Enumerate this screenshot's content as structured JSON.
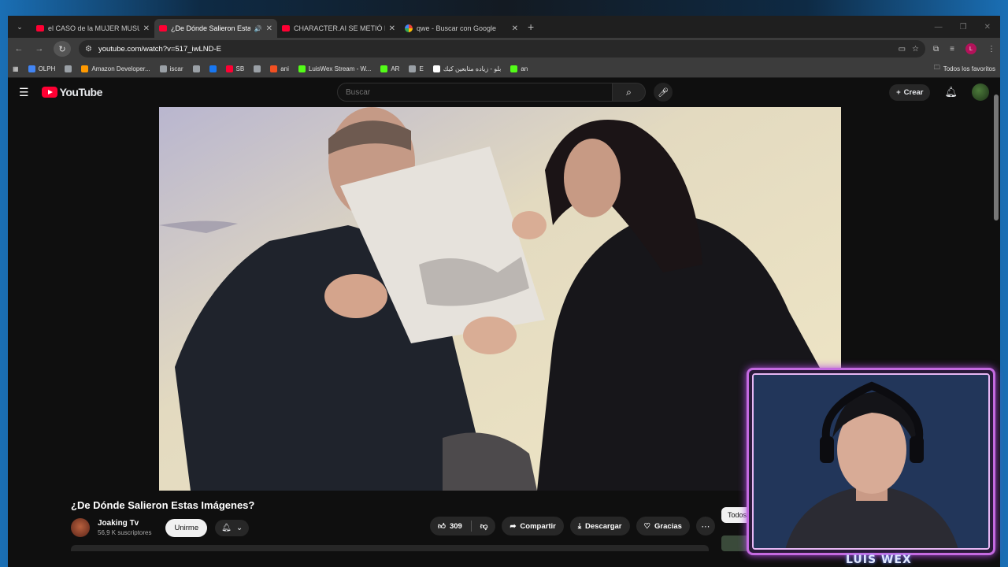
{
  "browser": {
    "tabs": [
      {
        "title": "el CASO de la MUJER MUSULMANA",
        "icon": "youtube-icon",
        "active": false
      },
      {
        "title": "¿De Dónde Salieron Estas Imágenes?",
        "icon": "youtube-icon",
        "active": true,
        "audio": true
      },
      {
        "title": "CHARACTER.AI SE METIÓ EN SERIO",
        "icon": "youtube-icon",
        "active": false
      },
      {
        "title": "qwe - Buscar con Google",
        "icon": "google-icon",
        "active": false
      }
    ],
    "url": "youtube.com/watch?v=517_iwLND-E",
    "profile_initial": "L",
    "bookmarks": [
      {
        "label": "OLPH",
        "color": "#4285f4"
      },
      {
        "label": "",
        "color": "#9aa0a6"
      },
      {
        "label": "Amazon Developer...",
        "color": "#ff9900"
      },
      {
        "label": "iscar",
        "color": "#9aa0a6"
      },
      {
        "label": "",
        "color": "#9aa0a6"
      },
      {
        "label": "",
        "color": "#1877f2"
      },
      {
        "label": "SB",
        "color": "#ff0033"
      },
      {
        "label": "",
        "color": "#9aa0a6"
      },
      {
        "label": "ani",
        "color": "#f25022"
      },
      {
        "label": "LuisWex Stream - W...",
        "color": "#53fc18"
      },
      {
        "label": "AR",
        "color": "#53fc18"
      },
      {
        "label": "E",
        "color": "#9aa0a6"
      },
      {
        "label": "بلو - زياده متابعين كيك",
        "color": "#ffffff"
      },
      {
        "label": "an",
        "color": "#53fc18"
      }
    ],
    "bookmarks_folder": "Todos los favoritos"
  },
  "youtube": {
    "logo_text": "YouTube",
    "search_placeholder": "Buscar",
    "create_label": "Crear",
    "video_title": "¿De Dónde Salieron Estas Imágenes?",
    "channel_name": "Joaking Tv",
    "channel_subs": "56,9 K suscriptores",
    "subscribe_label": "Unirme",
    "like_count": "309",
    "share_label": "Compartir",
    "download_label": "Descargar",
    "thanks_label": "Gracias",
    "chip_label": "Todos"
  },
  "overlay": {
    "webcam_label": "LUIS WEX"
  },
  "colors": {
    "youtube_red": "#ff0033",
    "webcam_border": "#c46ae0"
  }
}
